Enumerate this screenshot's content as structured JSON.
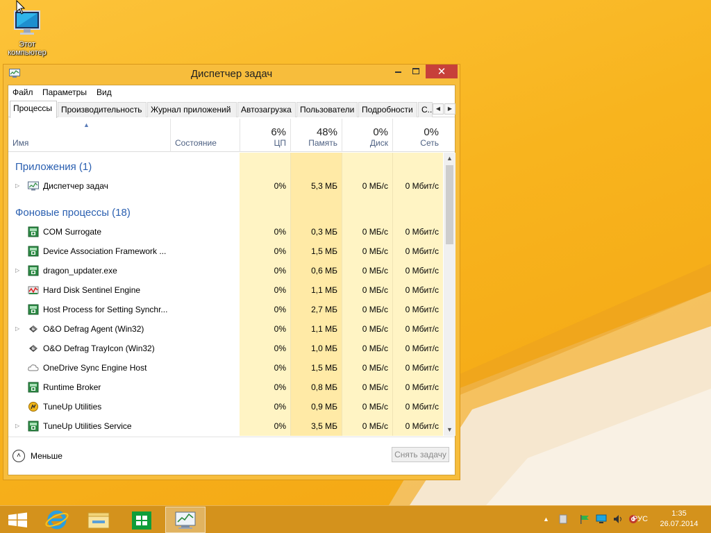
{
  "desktop": {
    "icon_label_line1": "Этот",
    "icon_label_line2": "компьютер"
  },
  "window": {
    "title": "Диспетчер задач",
    "menu": [
      "Файл",
      "Параметры",
      "Вид"
    ],
    "tabs": [
      "Процессы",
      "Производительность",
      "Журнал приложений",
      "Автозагрузка",
      "Пользователи",
      "Подробности",
      "С..."
    ],
    "active_tab": "Процессы",
    "columns": {
      "name": "Имя",
      "status": "Состояние",
      "cpu": {
        "pct": "6%",
        "label": "ЦП"
      },
      "memory": {
        "pct": "48%",
        "label": "Память"
      },
      "disk": {
        "pct": "0%",
        "label": "Диск"
      },
      "network": {
        "pct": "0%",
        "label": "Сеть"
      }
    },
    "groups": {
      "apps": "Приложения (1)",
      "background": "Фоновые процессы (18)"
    },
    "app_processes": [
      {
        "name": "Диспетчер задач",
        "cpu": "0%",
        "mem": "5,3 МБ",
        "disk": "0 МБ/с",
        "net": "0 Мбит/с",
        "expandable": true,
        "icon": "task-manager-icon"
      }
    ],
    "background_processes": [
      {
        "name": "COM Surrogate",
        "cpu": "0%",
        "mem": "0,3 МБ",
        "disk": "0 МБ/с",
        "net": "0 Мбит/с",
        "expandable": false,
        "icon": "service-icon"
      },
      {
        "name": "Device Association Framework ...",
        "cpu": "0%",
        "mem": "1,5 МБ",
        "disk": "0 МБ/с",
        "net": "0 Мбит/с",
        "expandable": false,
        "icon": "service-icon"
      },
      {
        "name": "dragon_updater.exe",
        "cpu": "0%",
        "mem": "0,6 МБ",
        "disk": "0 МБ/с",
        "net": "0 Мбит/с",
        "expandable": true,
        "icon": "service-icon"
      },
      {
        "name": "Hard Disk Sentinel Engine",
        "cpu": "0%",
        "mem": "1,1 МБ",
        "disk": "0 МБ/с",
        "net": "0 Мбит/с",
        "expandable": false,
        "icon": "sentinel-icon"
      },
      {
        "name": "Host Process for Setting Synchr...",
        "cpu": "0%",
        "mem": "2,7 МБ",
        "disk": "0 МБ/с",
        "net": "0 Мбит/с",
        "expandable": false,
        "icon": "service-icon"
      },
      {
        "name": "O&O Defrag Agent (Win32)",
        "cpu": "0%",
        "mem": "1,1 МБ",
        "disk": "0 МБ/с",
        "net": "0 Мбит/с",
        "expandable": true,
        "icon": "defrag-icon"
      },
      {
        "name": "O&O Defrag TrayIcon (Win32)",
        "cpu": "0%",
        "mem": "1,0 МБ",
        "disk": "0 МБ/с",
        "net": "0 Мбит/с",
        "expandable": false,
        "icon": "defrag-icon"
      },
      {
        "name": "OneDrive Sync Engine Host",
        "cpu": "0%",
        "mem": "1,5 МБ",
        "disk": "0 МБ/с",
        "net": "0 Мбит/с",
        "expandable": false,
        "icon": "cloud-icon"
      },
      {
        "name": "Runtime Broker",
        "cpu": "0%",
        "mem": "0,8 МБ",
        "disk": "0 МБ/с",
        "net": "0 Мбит/с",
        "expandable": false,
        "icon": "service-icon"
      },
      {
        "name": "TuneUp Utilities",
        "cpu": "0%",
        "mem": "0,9 МБ",
        "disk": "0 МБ/с",
        "net": "0 Мбит/с",
        "expandable": false,
        "icon": "tuneup-icon"
      },
      {
        "name": "TuneUp Utilities Service",
        "cpu": "0%",
        "mem": "3,5 МБ",
        "disk": "0 МБ/с",
        "net": "0 Мбит/с",
        "expandable": true,
        "icon": "service-icon"
      }
    ],
    "footer": {
      "less_label": "Меньше",
      "end_task_label": "Снять задачу"
    }
  },
  "taskbar": {
    "language": "РУС",
    "time": "1:35",
    "date": "26.07.2014"
  },
  "colors": {
    "accent_bg": "#f7bd3c",
    "cpu_column": "#fff4c4",
    "memory_column": "#ffeaa6",
    "group_title": "#2a5fb0",
    "close_button": "#c7403a"
  }
}
